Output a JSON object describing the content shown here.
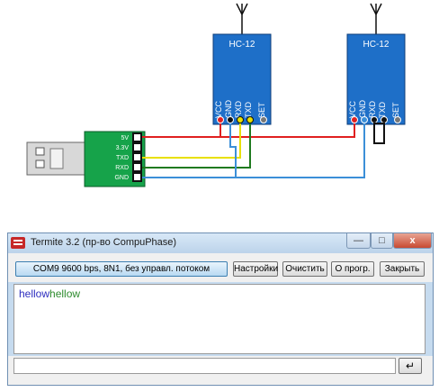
{
  "diagram": {
    "module_left_label": "HC-12",
    "module_right_label": "HC-12",
    "hc12_pins": [
      "VCC",
      "GND",
      "RXD",
      "TXD",
      "SET"
    ],
    "usb_pins": [
      "5V",
      "3.3V",
      "TXD",
      "RXD",
      "GND"
    ],
    "colors": {
      "module": "#1e6fc8",
      "adapter": "#16a34a",
      "wire_red": "#e02020",
      "wire_yellow": "#e8e000",
      "wire_green": "#1f7a1f",
      "wire_blue": "#3b8fd8",
      "wire_black": "#111111"
    }
  },
  "window": {
    "title": "Termite 3.2 (пр-во CompuPhase)",
    "min_glyph": "—",
    "max_glyph": "□",
    "close_glyph": "x",
    "com_settings": "COM9 9600 bps, 8N1, без управл. потоком",
    "buttons": {
      "settings": "Настройки",
      "clear": "Очистить",
      "about": "О прогр.",
      "close": "Закрыть"
    },
    "output": {
      "sent": "hellow",
      "received": "hellow"
    },
    "input_value": "",
    "send_glyph": "↵"
  }
}
